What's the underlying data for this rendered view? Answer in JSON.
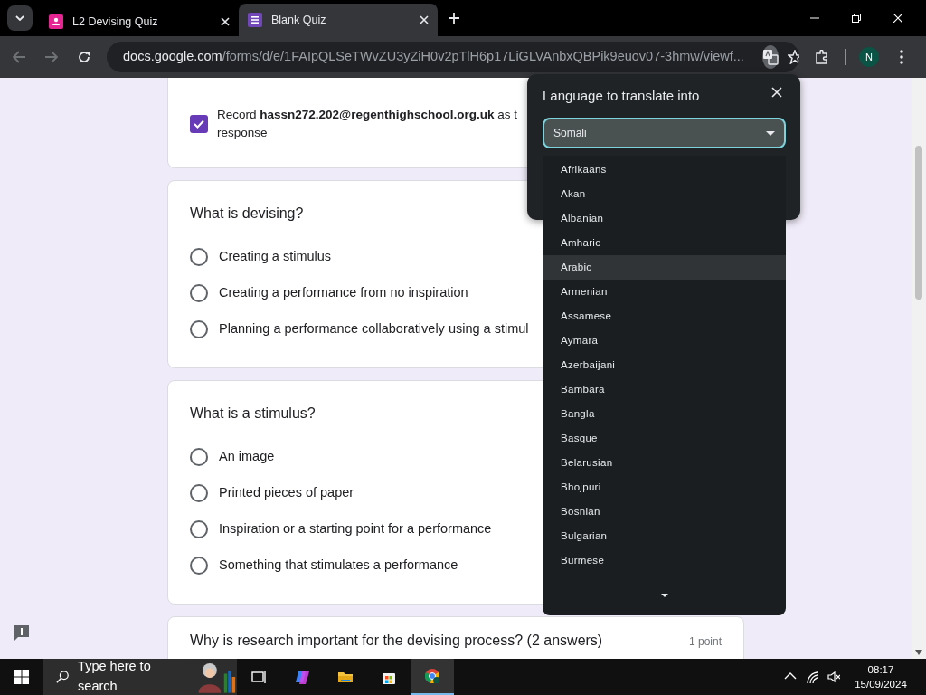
{
  "browser": {
    "tabs": [
      {
        "title": "L2 Devising Quiz",
        "selected": false
      },
      {
        "title": "Blank Quiz",
        "selected": true
      }
    ],
    "url_host": "docs.google.com",
    "url_path": "/forms/d/e/1FAIpQLSeTWvZU3yZiH0v2pTlH6p17LiGLVAnbxQBPik9euov07-3hmw/viewf...",
    "profile_initial": "N"
  },
  "form": {
    "record_lines": [
      "Record **hassn272.202@regenthighschool.org.uk** as t",
      "response"
    ],
    "record_checked": true,
    "questions": [
      {
        "title": "What is devising?",
        "options": [
          {
            "label": "Creating a stimulus",
            "selected": false
          },
          {
            "label": "Creating a performance from no inspiration",
            "selected": false
          },
          {
            "label": "Planning a performance collaboratively using a stimul",
            "selected": false
          }
        ]
      },
      {
        "title": "What is a stimulus?",
        "options": [
          {
            "label": "An image",
            "selected": false
          },
          {
            "label": "Printed pieces of paper",
            "selected": false
          },
          {
            "label": "Inspiration or a starting point for a performance",
            "selected": false
          },
          {
            "label": "Something that stimulates a performance",
            "selected": false
          }
        ]
      },
      {
        "title": "Why is research important for the devising process? (2 answers)",
        "points": "1 point"
      }
    ]
  },
  "translate_popup": {
    "title": "Language to translate into",
    "selected_language": "Somali",
    "options": [
      {
        "label": "Afrikaans",
        "selected": false
      },
      {
        "label": "Akan",
        "selected": false
      },
      {
        "label": "Albanian",
        "selected": false
      },
      {
        "label": "Amharic",
        "selected": false
      },
      {
        "label": "Arabic",
        "selected": true
      },
      {
        "label": "Armenian",
        "selected": false
      },
      {
        "label": "Assamese",
        "selected": false
      },
      {
        "label": "Aymara",
        "selected": false
      },
      {
        "label": "Azerbaijani",
        "selected": false
      },
      {
        "label": "Bambara",
        "selected": false
      },
      {
        "label": "Bangla",
        "selected": false
      },
      {
        "label": "Basque",
        "selected": false
      },
      {
        "label": "Belarusian",
        "selected": false
      },
      {
        "label": "Bhojpuri",
        "selected": false
      },
      {
        "label": "Bosnian",
        "selected": false
      },
      {
        "label": "Bulgarian",
        "selected": false
      },
      {
        "label": "Burmese",
        "selected": false
      }
    ]
  },
  "taskbar": {
    "search_placeholder": "Type here to search",
    "time": "08:17",
    "date": "15/09/2024"
  }
}
